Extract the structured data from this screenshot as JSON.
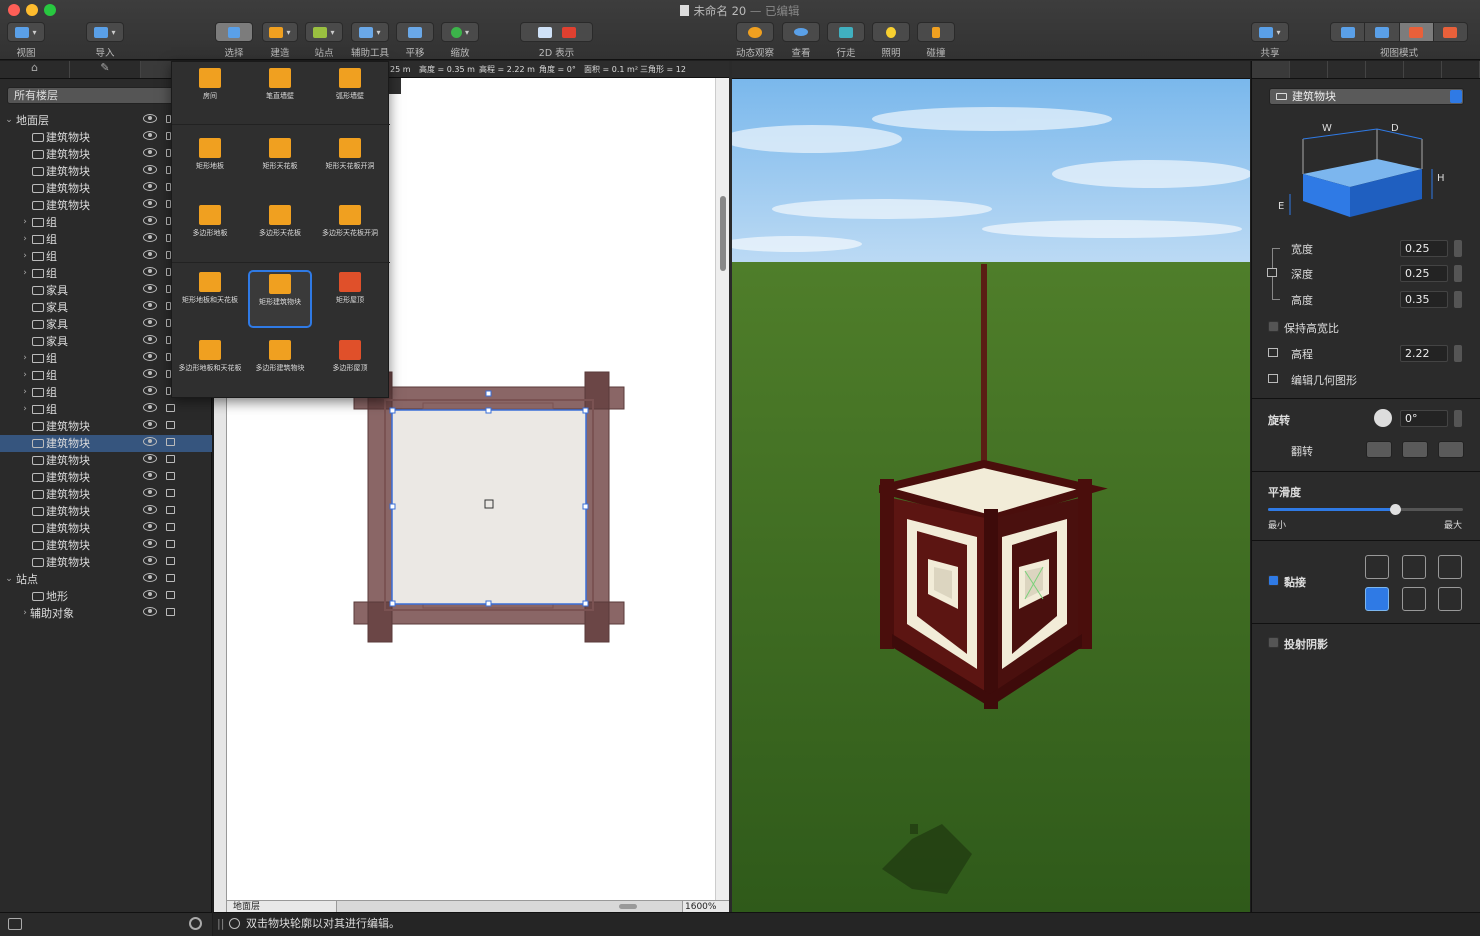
{
  "window": {
    "title": "未命名 20",
    "subtitle": "— 已编辑"
  },
  "toolbar": {
    "view": "视图",
    "import": "导入",
    "select": "选择",
    "build": "建造",
    "sites": "站点",
    "guides": "辅助工具",
    "pan": "平移",
    "zoom": "缩放",
    "view2d": "2D 表示",
    "orbit": "动态观察",
    "look": "查看",
    "walk": "行走",
    "lighting": "照明",
    "collision": "碰撞",
    "share": "共享",
    "view_mode": "视图模式"
  },
  "left": {
    "floors_select": "所有楼层",
    "tree": [
      {
        "label": "地面层",
        "level": 0,
        "expand": "v",
        "icon": "none",
        "lock": false
      },
      {
        "label": "建筑物块",
        "level": 1,
        "expand": "",
        "icon": "block",
        "lock": false
      },
      {
        "label": "建筑物块",
        "level": 1,
        "expand": "",
        "icon": "block",
        "lock": false
      },
      {
        "label": "建筑物块",
        "level": 1,
        "expand": "",
        "icon": "block",
        "lock": false
      },
      {
        "label": "建筑物块",
        "level": 1,
        "expand": "",
        "icon": "block",
        "lock": false
      },
      {
        "label": "建筑物块",
        "level": 1,
        "expand": "",
        "icon": "block",
        "lock": false
      },
      {
        "label": "组",
        "level": 1,
        "expand": ">",
        "icon": "folder",
        "lock": false
      },
      {
        "label": "组",
        "level": 1,
        "expand": ">",
        "icon": "folder",
        "lock": false
      },
      {
        "label": "组",
        "level": 1,
        "expand": ">",
        "icon": "folder",
        "lock": false
      },
      {
        "label": "组",
        "level": 1,
        "expand": ">",
        "icon": "folder",
        "lock": false
      },
      {
        "label": "家具",
        "level": 1,
        "expand": "",
        "icon": "furniture",
        "lock": false
      },
      {
        "label": "家具",
        "level": 1,
        "expand": "",
        "icon": "furniture",
        "lock": false
      },
      {
        "label": "家具",
        "level": 1,
        "expand": "",
        "icon": "furniture",
        "lock": false
      },
      {
        "label": "家具",
        "level": 1,
        "expand": "",
        "icon": "furniture",
        "lock": false
      },
      {
        "label": "组",
        "level": 1,
        "expand": ">",
        "icon": "folder",
        "lock": false
      },
      {
        "label": "组",
        "level": 1,
        "expand": ">",
        "icon": "folder",
        "lock": false
      },
      {
        "label": "组",
        "level": 1,
        "expand": ">",
        "icon": "folder",
        "lock": false
      },
      {
        "label": "组",
        "level": 1,
        "expand": ">",
        "icon": "folder",
        "lock": true
      },
      {
        "label": "建筑物块",
        "level": 1,
        "expand": "",
        "icon": "block",
        "lock": true
      },
      {
        "label": "建筑物块",
        "level": 1,
        "expand": "",
        "icon": "block",
        "lock": true,
        "selected": true
      },
      {
        "label": "建筑物块",
        "level": 1,
        "expand": "",
        "icon": "block",
        "lock": true
      },
      {
        "label": "建筑物块",
        "level": 1,
        "expand": "",
        "icon": "block",
        "lock": true
      },
      {
        "label": "建筑物块",
        "level": 1,
        "expand": "",
        "icon": "block",
        "lock": true
      },
      {
        "label": "建筑物块",
        "level": 1,
        "expand": "",
        "icon": "block",
        "lock": true
      },
      {
        "label": "建筑物块",
        "level": 1,
        "expand": "",
        "icon": "block",
        "lock": true
      },
      {
        "label": "建筑物块",
        "level": 1,
        "expand": "",
        "icon": "block",
        "lock": true
      },
      {
        "label": "建筑物块",
        "level": 1,
        "expand": "",
        "icon": "block",
        "lock": true
      },
      {
        "label": "站点",
        "level": 0,
        "expand": "v",
        "icon": "none",
        "lock": true
      },
      {
        "label": "地形",
        "level": 1,
        "expand": "",
        "icon": "terrain",
        "lock": true
      },
      {
        "label": "辅助对象",
        "level": 1,
        "expand": ">",
        "icon": "none",
        "lock": true
      }
    ]
  },
  "palette": {
    "items": [
      {
        "label": "房间",
        "color": "#f0a020"
      },
      {
        "label": "笔直墙壁",
        "color": "#f0a020"
      },
      {
        "label": "弧形墙壁",
        "color": "#f0a020"
      },
      {
        "label": "矩形地板",
        "color": "#f0a020"
      },
      {
        "label": "矩形天花板",
        "color": "#f0a020"
      },
      {
        "label": "矩形天花板开洞",
        "color": "#f0a020"
      },
      {
        "label": "多边形地板",
        "color": "#f0a020"
      },
      {
        "label": "多边形天花板",
        "color": "#f0a020"
      },
      {
        "label": "多边形天花板开洞",
        "color": "#f0a020"
      },
      {
        "label": "矩形地板和天花板",
        "color": "#f0a020"
      },
      {
        "label": "矩形建筑物块",
        "color": "#f0a020",
        "selected": true
      },
      {
        "label": "矩形屋顶",
        "color": "#e0502a"
      },
      {
        "label": "多边形地板和天花板",
        "color": "#f0a020"
      },
      {
        "label": "多边形建筑物块",
        "color": "#f0a020"
      },
      {
        "label": "多边形屋顶",
        "color": "#e0502a"
      }
    ]
  },
  "plan": {
    "info_width": "25 m",
    "info_depth": "高度 = 0.35 m",
    "info_elev": "高程 = 2.22 m",
    "info_angle": "角度 = 0°",
    "info_area": "面积 = 0.1 m²",
    "info_tris": "三角形 = 12",
    "floor_select": "地面层",
    "zoom": "1600%"
  },
  "inspector": {
    "type": "建筑物块",
    "diagram": {
      "w": "W",
      "d": "D",
      "h": "H",
      "e": "E"
    },
    "width_label": "宽度",
    "width": "0.25",
    "depth_label": "深度",
    "depth": "0.25",
    "height_label": "高度",
    "height": "0.35",
    "keep_ratio": "保持高宽比",
    "elevation_label": "高程",
    "elevation": "2.22",
    "edit_geometry": "编辑几何图形",
    "rotation_label": "旋转",
    "rotation": "0°",
    "flip_label": "翻转",
    "smooth_label": "平滑度",
    "smooth_value": 0.65,
    "smooth_min": "最小",
    "smooth_max": "最大",
    "snap_label": "黏接",
    "shadow_label": "投射阴影"
  },
  "status": {
    "message": "双击物块轮廓以对其进行编辑。"
  },
  "colors": {
    "accent": "#2f7ae5",
    "selection": "#36557e",
    "wood": "#5a1410",
    "sky": "#8dc4ec",
    "grass": "#3f6b22"
  }
}
